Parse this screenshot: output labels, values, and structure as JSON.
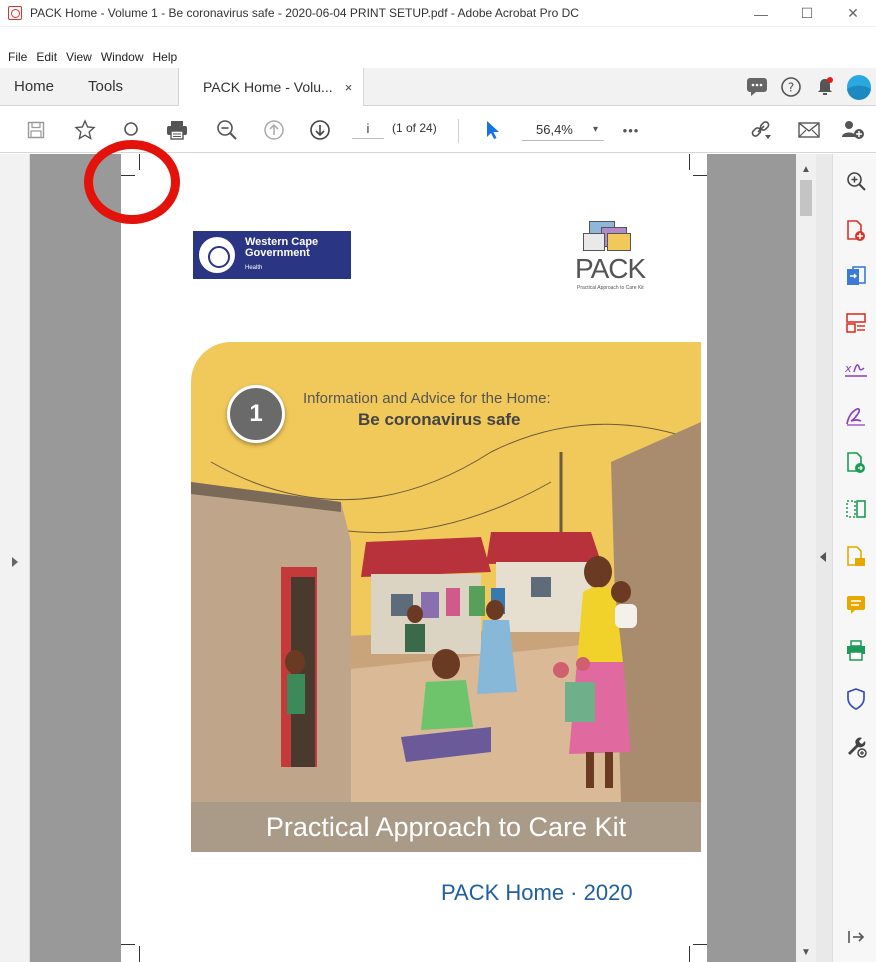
{
  "window": {
    "title": "PACK Home - Volume  1 - Be coronavirus safe - 2020-06-04 PRINT SETUP.pdf - Adobe Acrobat Pro DC",
    "controls": [
      "—",
      "☐",
      "✕"
    ]
  },
  "menu": [
    "File",
    "Edit",
    "View",
    "Window",
    "Help"
  ],
  "tabs": {
    "home": "Home",
    "tools": "Tools",
    "document": "PACK Home - Volu...",
    "close": "×"
  },
  "toolbar": {
    "page_value": "i",
    "page_count": "(1 of 24)",
    "zoom_value": "56,4%",
    "zoom_caret": "▾",
    "more": "•••"
  },
  "document": {
    "wcg_logo_line1": "Western Cape",
    "wcg_logo_line2": "Government",
    "wcg_logo_line3": "Health",
    "pack_logo_word": "PACK",
    "pack_logo_sub": "Practical Approach to Care Kit",
    "cover_number": "1",
    "cover_line1": "Information and Advice for the Home:",
    "cover_line2": "Be coronavirus safe",
    "cover_band": "Practical Approach to Care Kit",
    "footer": "PACK Home · 2020"
  },
  "scroll": {
    "up": "▲",
    "down": "▼"
  },
  "colors": {
    "acrobat_red": "#d9342b",
    "annotation_red": "#e3120b",
    "wcg_blue": "#2a3583",
    "cover_yellow": "#f1c85a",
    "band_brown": "#a99b87",
    "footer_blue": "#2060a0"
  }
}
